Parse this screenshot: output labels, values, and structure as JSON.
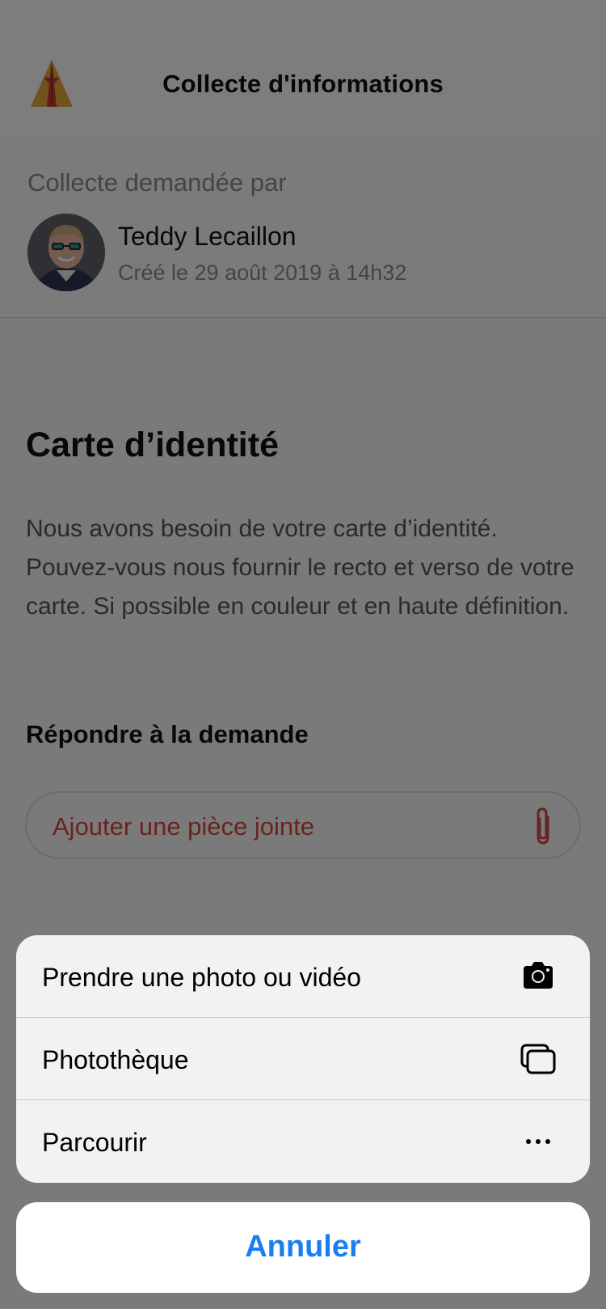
{
  "header": {
    "title": "Collecte d'informations"
  },
  "requester": {
    "caption": "Collecte demandée par",
    "name": "Teddy Lecaillon",
    "created": "Créé le 29 août 2019 à 14h32"
  },
  "document": {
    "title": "Carte d’identité",
    "description": "Nous avons besoin de votre carte d’identité. Pouvez-vous nous fournir le recto et verso de votre carte. Si possible en couleur et en haute définition."
  },
  "respond": {
    "label": "Répondre à la demande",
    "attach_placeholder": "Ajouter une pièce jointe"
  },
  "action_sheet": {
    "items": [
      {
        "label": "Prendre une photo ou vidéo",
        "icon": "camera-icon"
      },
      {
        "label": "Photothèque",
        "icon": "photo-library-icon"
      },
      {
        "label": "Parcourir",
        "icon": "more-icon"
      }
    ],
    "cancel_label": "Annuler"
  },
  "colors": {
    "accent_red": "#d1493f",
    "ios_blue": "#1a7ef2",
    "logo_gold": "#e0a43a"
  }
}
